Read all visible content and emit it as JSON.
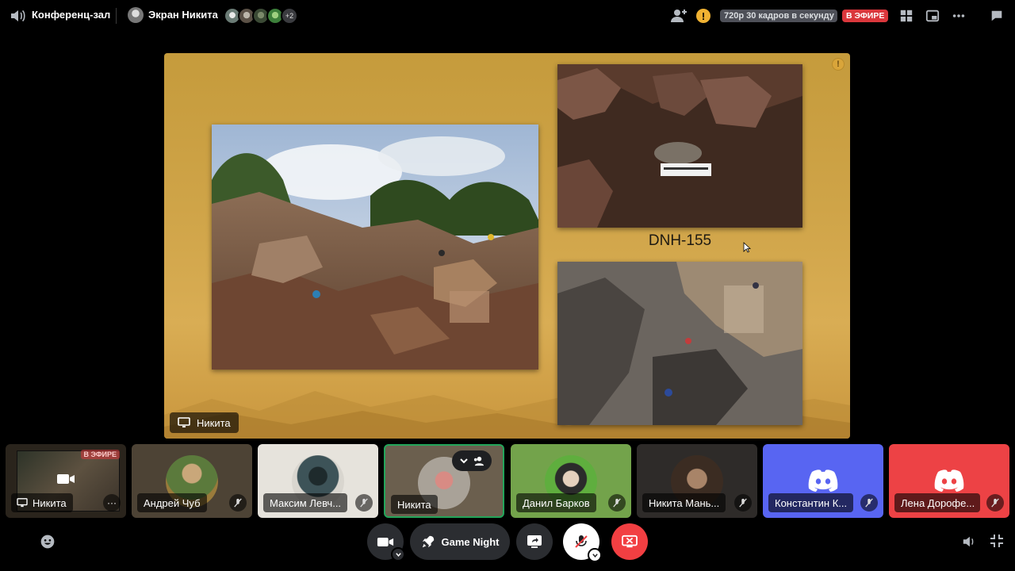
{
  "topbar": {
    "channel_name": "Конференц-зал",
    "screen_owner": "Экран Никита",
    "extra_participants": "+2",
    "quality_label": "720p 30 кадров в секунду",
    "live_label": "В ЭФИРЕ",
    "warning_glyph": "!"
  },
  "stage": {
    "caption": "DNH-155",
    "streamer_name": "Никита"
  },
  "participants": [
    {
      "name": "Никита",
      "live": "В ЭФИРЕ",
      "more": "···"
    },
    {
      "name": "Андрей Чуб"
    },
    {
      "name": "Максим Левч..."
    },
    {
      "name": "Никита"
    },
    {
      "name": "Данил Барков"
    },
    {
      "name": "Никита Мань..."
    },
    {
      "name": "Константин К..."
    },
    {
      "name": "Лена Дорофе..."
    }
  ],
  "controls": {
    "activity_label": "Game Night"
  },
  "colors": {
    "live": "#da373c",
    "blurple": "#5865f2",
    "discord_red": "#ed4245",
    "speaking_green": "#23a55a",
    "leave_red": "#f23f42",
    "warning": "#f0b232"
  }
}
